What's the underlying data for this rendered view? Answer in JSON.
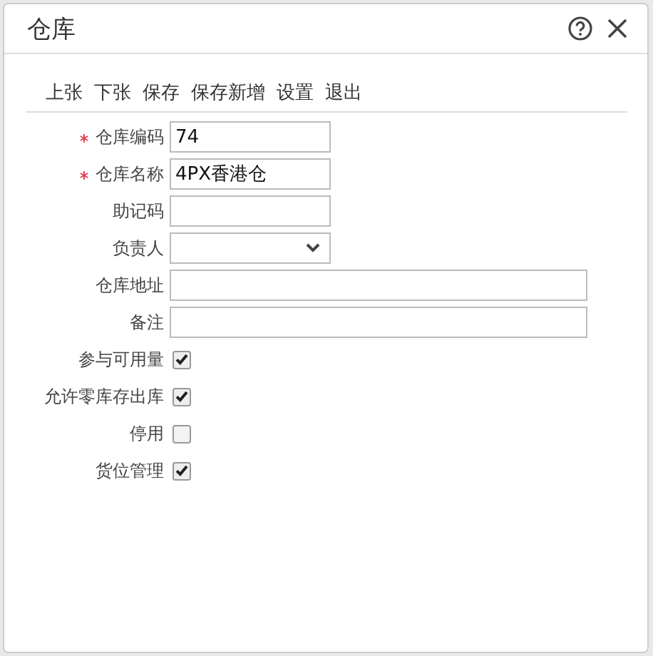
{
  "window": {
    "title": "仓库"
  },
  "toolbar": [
    "上张",
    "下张",
    "保存",
    "保存新增",
    "设置",
    "退出"
  ],
  "fields": [
    {
      "kind": "text",
      "label": "仓库编码",
      "required": true,
      "value": "74",
      "wide": false
    },
    {
      "kind": "text",
      "label": "仓库名称",
      "required": true,
      "value": "4PX香港仓",
      "wide": false
    },
    {
      "kind": "text",
      "label": "助记码",
      "required": false,
      "wide": false
    },
    {
      "kind": "select",
      "label": "负责人",
      "required": false,
      "wide": false
    },
    {
      "kind": "text",
      "label": "仓库地址",
      "required": false,
      "wide": true
    },
    {
      "kind": "text",
      "label": "备注",
      "required": false,
      "wide": true
    },
    {
      "kind": "checkbox",
      "label": "参与可用量",
      "checked": true
    },
    {
      "kind": "checkbox",
      "label": "允许零库存出库",
      "checked": true
    },
    {
      "kind": "checkbox",
      "label": "停用",
      "checked": false
    },
    {
      "kind": "checkbox",
      "label": "货位管理",
      "checked": true
    }
  ]
}
